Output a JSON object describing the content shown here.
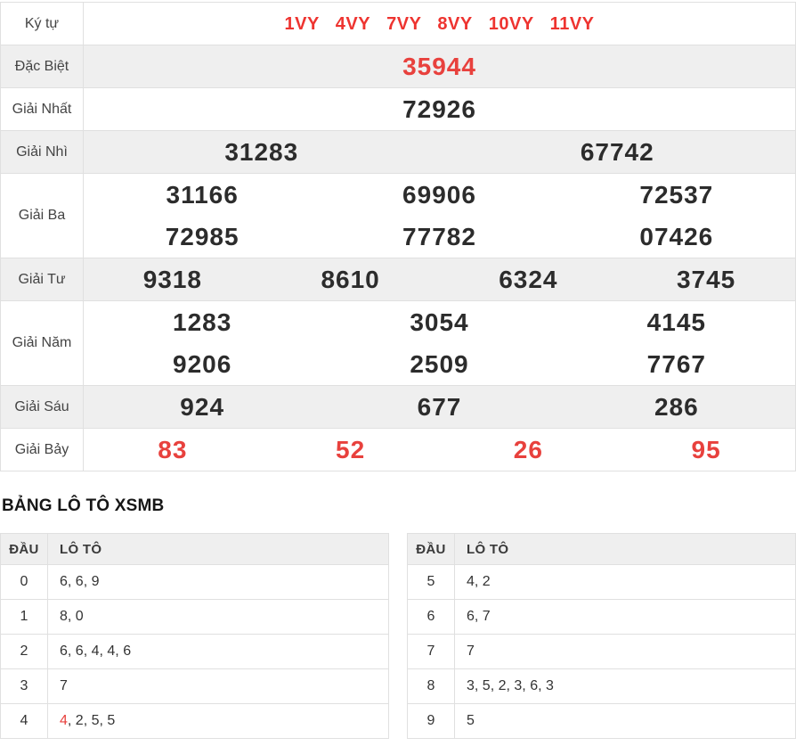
{
  "colors": {
    "accent_red": "#e8413d",
    "kytu_red": "#ee3430",
    "number_dark": "#2c2c2c",
    "row_alt_bg": "#efefef",
    "border": "#e0e0e0"
  },
  "prize_table": {
    "rows": [
      {
        "label": "Ký tự",
        "type": "kytu",
        "red": true,
        "lines": [
          [
            "1VY",
            "4VY",
            "7VY",
            "8VY",
            "10VY",
            "11VY"
          ]
        ]
      },
      {
        "label": "Đặc Biệt",
        "type": "special",
        "red": true,
        "lines": [
          [
            "35944"
          ]
        ]
      },
      {
        "label": "Giải Nhất",
        "lines": [
          [
            "72926"
          ]
        ]
      },
      {
        "label": "Giải Nhì",
        "lines": [
          [
            "31283",
            "67742"
          ]
        ]
      },
      {
        "label": "Giải Ba",
        "lines": [
          [
            "31166",
            "69906",
            "72537"
          ],
          [
            "72985",
            "77782",
            "07426"
          ]
        ]
      },
      {
        "label": "Giải Tư",
        "lines": [
          [
            "9318",
            "8610",
            "6324",
            "3745"
          ]
        ]
      },
      {
        "label": "Giải Năm",
        "lines": [
          [
            "1283",
            "3054",
            "4145"
          ],
          [
            "9206",
            "2509",
            "7767"
          ]
        ]
      },
      {
        "label": "Giải Sáu",
        "lines": [
          [
            "924",
            "677",
            "286"
          ]
        ]
      },
      {
        "label": "Giải Bảy",
        "red": true,
        "lines": [
          [
            "83",
            "52",
            "26",
            "95"
          ]
        ]
      }
    ]
  },
  "loto": {
    "heading": "BẢNG LÔ TÔ XSMB",
    "col_dau": "ĐẦU",
    "col_loto": "LÔ TÔ",
    "tables": [
      {
        "rows": [
          {
            "dau": "0",
            "values": [
              {
                "v": "6"
              },
              {
                "v": "6"
              },
              {
                "v": "9"
              }
            ]
          },
          {
            "dau": "1",
            "values": [
              {
                "v": "8"
              },
              {
                "v": "0"
              }
            ]
          },
          {
            "dau": "2",
            "values": [
              {
                "v": "6"
              },
              {
                "v": "6"
              },
              {
                "v": "4"
              },
              {
                "v": "4"
              },
              {
                "v": "6"
              }
            ]
          },
          {
            "dau": "3",
            "values": [
              {
                "v": "7"
              }
            ]
          },
          {
            "dau": "4",
            "values": [
              {
                "v": "4",
                "red": true
              },
              {
                "v": "2"
              },
              {
                "v": "5"
              },
              {
                "v": "5"
              }
            ]
          }
        ]
      },
      {
        "rows": [
          {
            "dau": "5",
            "values": [
              {
                "v": "4"
              },
              {
                "v": "2"
              }
            ]
          },
          {
            "dau": "6",
            "values": [
              {
                "v": "6"
              },
              {
                "v": "7"
              }
            ]
          },
          {
            "dau": "7",
            "values": [
              {
                "v": "7"
              }
            ]
          },
          {
            "dau": "8",
            "values": [
              {
                "v": "3"
              },
              {
                "v": "5"
              },
              {
                "v": "2"
              },
              {
                "v": "3"
              },
              {
                "v": "6"
              },
              {
                "v": "3"
              }
            ]
          },
          {
            "dau": "9",
            "values": [
              {
                "v": "5"
              }
            ]
          }
        ]
      }
    ]
  }
}
